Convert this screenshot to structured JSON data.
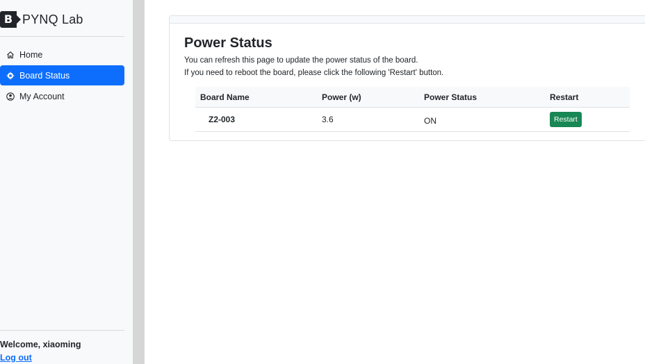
{
  "sidebar": {
    "brand_letter": "B",
    "brand_name": "PYNQ Lab",
    "items": [
      {
        "label": "Home",
        "icon": "home-icon"
      },
      {
        "label": "Board Status",
        "icon": "cpu-icon",
        "active": true
      },
      {
        "label": "My Account",
        "icon": "user-circle-icon"
      }
    ],
    "welcome": "Welcome, xiaoming",
    "logout": "Log out"
  },
  "main": {
    "title": "Power Status",
    "description_1": "You can refresh this page to update the power status of the board.",
    "description_2": "If you need to reboot the board, please click the following 'Restart' button.",
    "table": {
      "headers": [
        "Board Name",
        "Power (w)",
        "Power Status",
        "Restart"
      ],
      "rows": [
        {
          "board_name": "Z2-003",
          "power": "3.6",
          "status": "ON",
          "action": "Restart"
        }
      ]
    }
  },
  "colors": {
    "primary": "#0d6efd",
    "success": "#198754",
    "sidebar_bg": "#f8f9fa"
  }
}
